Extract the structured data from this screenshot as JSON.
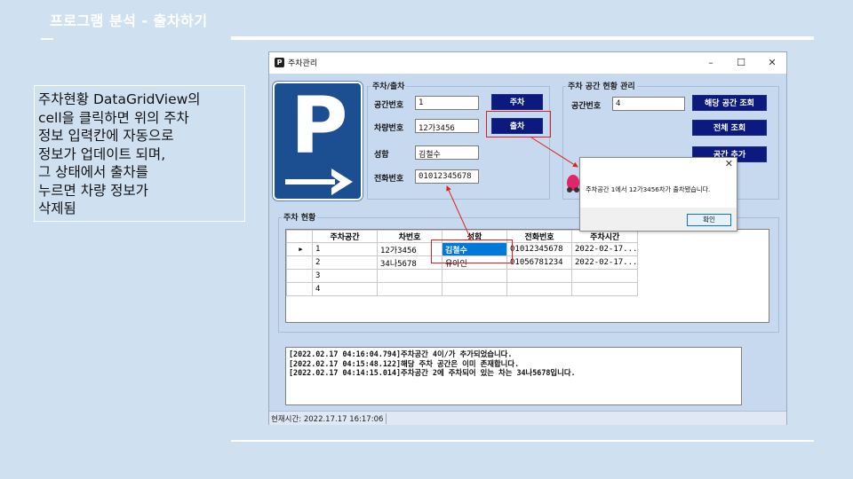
{
  "slide": {
    "title": "프로그램 분석 - 출차하기",
    "note_lines": [
      "주차현황 DataGridView의",
      "cell을 클릭하면 위의 주차",
      "정보 입력칸에 자동으로",
      "정보가 업데이트 되며,",
      "그 상태에서 출차를",
      "누르면 차량 정보가",
      "삭제됨"
    ]
  },
  "window": {
    "title": "주차관리",
    "controls": {
      "minimize": "–",
      "maximize": "☐",
      "close": "✕"
    },
    "logo_letter": "P",
    "parking_group": {
      "label": "주차/출차",
      "space_label": "공간번호",
      "space_value": "1",
      "car_label": "차량번호",
      "car_value": "12가3456",
      "name_label": "성함",
      "name_value": "김철수",
      "phone_label": "전화번호",
      "phone_value": "01012345678",
      "park_button": "주차",
      "exit_button": "출차"
    },
    "space_group": {
      "label": "주차 공간 현황 관리",
      "space_label": "공간번호",
      "space_value": "4",
      "lookup_button": "해당 공간 조회",
      "all_button": "전체 조회",
      "add_button": "공간 추가"
    },
    "status_group": {
      "label": "주차 현황",
      "columns": [
        "주차공간",
        "차번호",
        "성함",
        "전화번호",
        "주차시간"
      ],
      "rows": [
        [
          "1",
          "12가3456",
          "김철수",
          "01012345678",
          "2022-02-17..."
        ],
        [
          "2",
          "34나5678",
          "유아인",
          "01056781234",
          "2022-02-17..."
        ],
        [
          "3",
          "",
          "",
          "",
          ""
        ],
        [
          "4",
          "",
          "",
          "",
          ""
        ]
      ],
      "row_indicator": "▶"
    },
    "log_lines": [
      "[2022.02.17 04:16:04.794]주차공간 4이/가 추가되었습니다.",
      "[2022.02.17 04:15:48.122]해당 주차 공간은 이미 존재합니다.",
      "[2022.02.17 04:14:15.014]주차공간 2에 주차되어 있는 차는 34나5678입니다."
    ],
    "status_bar": "현재시간: 2022.17.17 16:17:06"
  },
  "message_box": {
    "text": "주차공간 1에서 12가3456차가 출차됐습니다.",
    "ok_button": "확인",
    "close": "✕"
  },
  "colors": {
    "slide_bg": "#cfe0f1",
    "window_bg": "#c7d9ef",
    "button_bg": "#0c1a80",
    "logo_bg": "#1c4f92",
    "highlight": "#e02020",
    "selected_cell": "#0078d7"
  }
}
